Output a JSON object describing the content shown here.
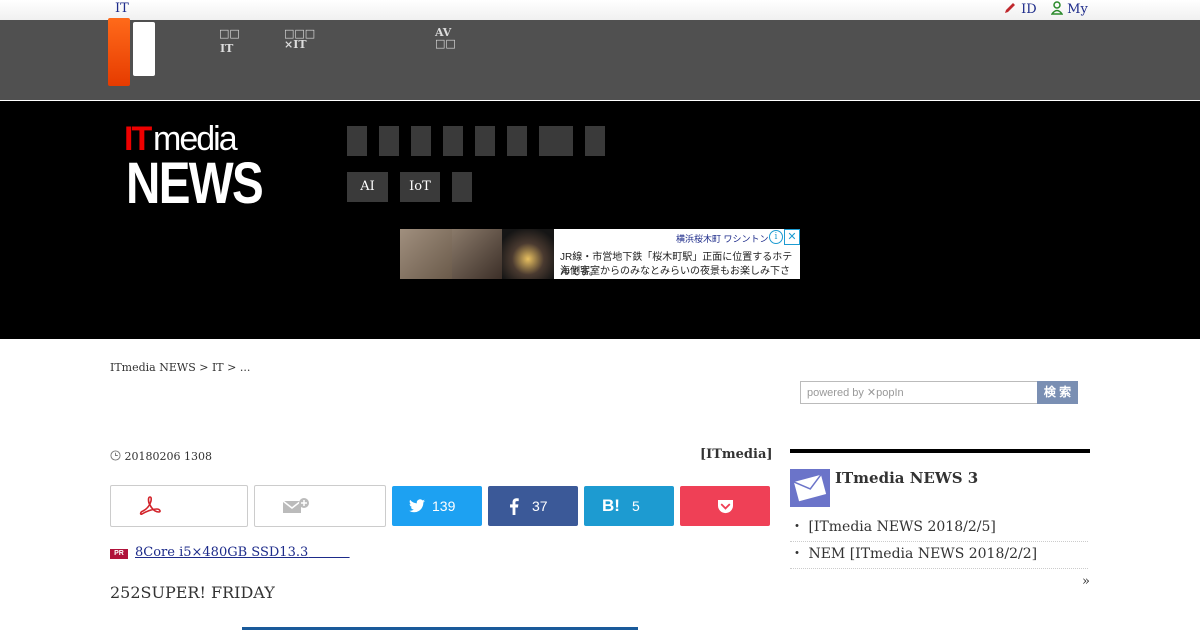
{
  "topbar": {
    "left_link": "IT",
    "id_link": "ID",
    "my_link": "My"
  },
  "global_nav": {
    "items": [
      {
        "line1": "□□",
        "line2": "IT"
      },
      {
        "line1": "□□□",
        "line2": "×IT"
      },
      {
        "line1": "AV",
        "line2": "□□"
      }
    ]
  },
  "logo": {
    "it": "IT",
    "media": "media",
    "news": "NEWS"
  },
  "categories": {
    "row1_count": 8,
    "row2": [
      "AI",
      "IoT",
      ""
    ]
  },
  "ad": {
    "brand": "横浜桜木町 ワシントン",
    "line1": "JR線・市営地下鉄「桜木町駅」正面に位置するホテルです。",
    "line2": "海側客室からのみなとみらいの夜景もお楽しみ下さい。"
  },
  "breadcrumb": "ITmedia NEWS > IT > ...",
  "search": {
    "placeholder": "powered by ✕popIn",
    "button": "検 索"
  },
  "article": {
    "date": "20180206 1308",
    "author": "[ITmedia]",
    "pr_label": "PR",
    "pr_link": "8Core i5×480GB SSD13.3",
    "lead": "252SUPER! FRIDAY"
  },
  "share": {
    "twitter": "139",
    "facebook": "37",
    "hatena": "5"
  },
  "sidebar": {
    "title": "ITmedia NEWS 3",
    "items": [
      "・ [ITmedia NEWS 2018/2/5]",
      "・ NEM [ITmedia NEWS 2018/2/2]"
    ],
    "more": "»"
  },
  "colors": {
    "twitter": "#1da1f2",
    "facebook": "#3b5998",
    "hatena": "#1d9bd1",
    "pocket": "#ef4056",
    "pdf": "#d2232a"
  }
}
